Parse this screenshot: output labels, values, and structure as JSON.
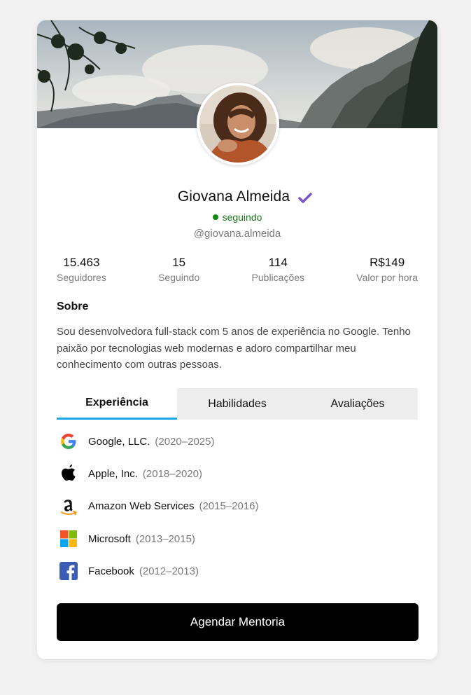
{
  "profile": {
    "name": "Giovana Almeida",
    "status": "seguindo",
    "handle": "@giovana.almeida"
  },
  "stats": [
    {
      "value": "15.463",
      "label": "Seguidores"
    },
    {
      "value": "15",
      "label": "Seguindo"
    },
    {
      "value": "114",
      "label": "Publicações"
    },
    {
      "value": "R$149",
      "label": "Valor por hora"
    }
  ],
  "about": {
    "title": "Sobre",
    "text": "Sou desenvolvedora full-stack com 5 anos de experiência no Google. Tenho paixão por tecnologias web modernas e adoro compartilhar meu conhecimento com outras pessoas."
  },
  "tabs": [
    {
      "label": "Experiência",
      "active": true
    },
    {
      "label": "Habilidades",
      "active": false
    },
    {
      "label": "Avaliações",
      "active": false
    }
  ],
  "experience": [
    {
      "company": "Google, LLC.",
      "period": "(2020–2025)",
      "icon": "google-icon"
    },
    {
      "company": "Apple, Inc.",
      "period": "(2018–2020)",
      "icon": "apple-icon"
    },
    {
      "company": "Amazon Web Services",
      "period": "(2015–2016)",
      "icon": "amazon-icon"
    },
    {
      "company": "Microsoft",
      "period": "(2013–2015)",
      "icon": "microsoft-icon"
    },
    {
      "company": "Facebook",
      "period": "(2012–2013)",
      "icon": "facebook-icon"
    }
  ],
  "cta": {
    "label": "Agendar Mentoria"
  },
  "colors": {
    "accent_tab": "#19a7e8",
    "verified": "#7a55c8",
    "status": "#0c8a0c",
    "cta_bg": "#000000"
  }
}
